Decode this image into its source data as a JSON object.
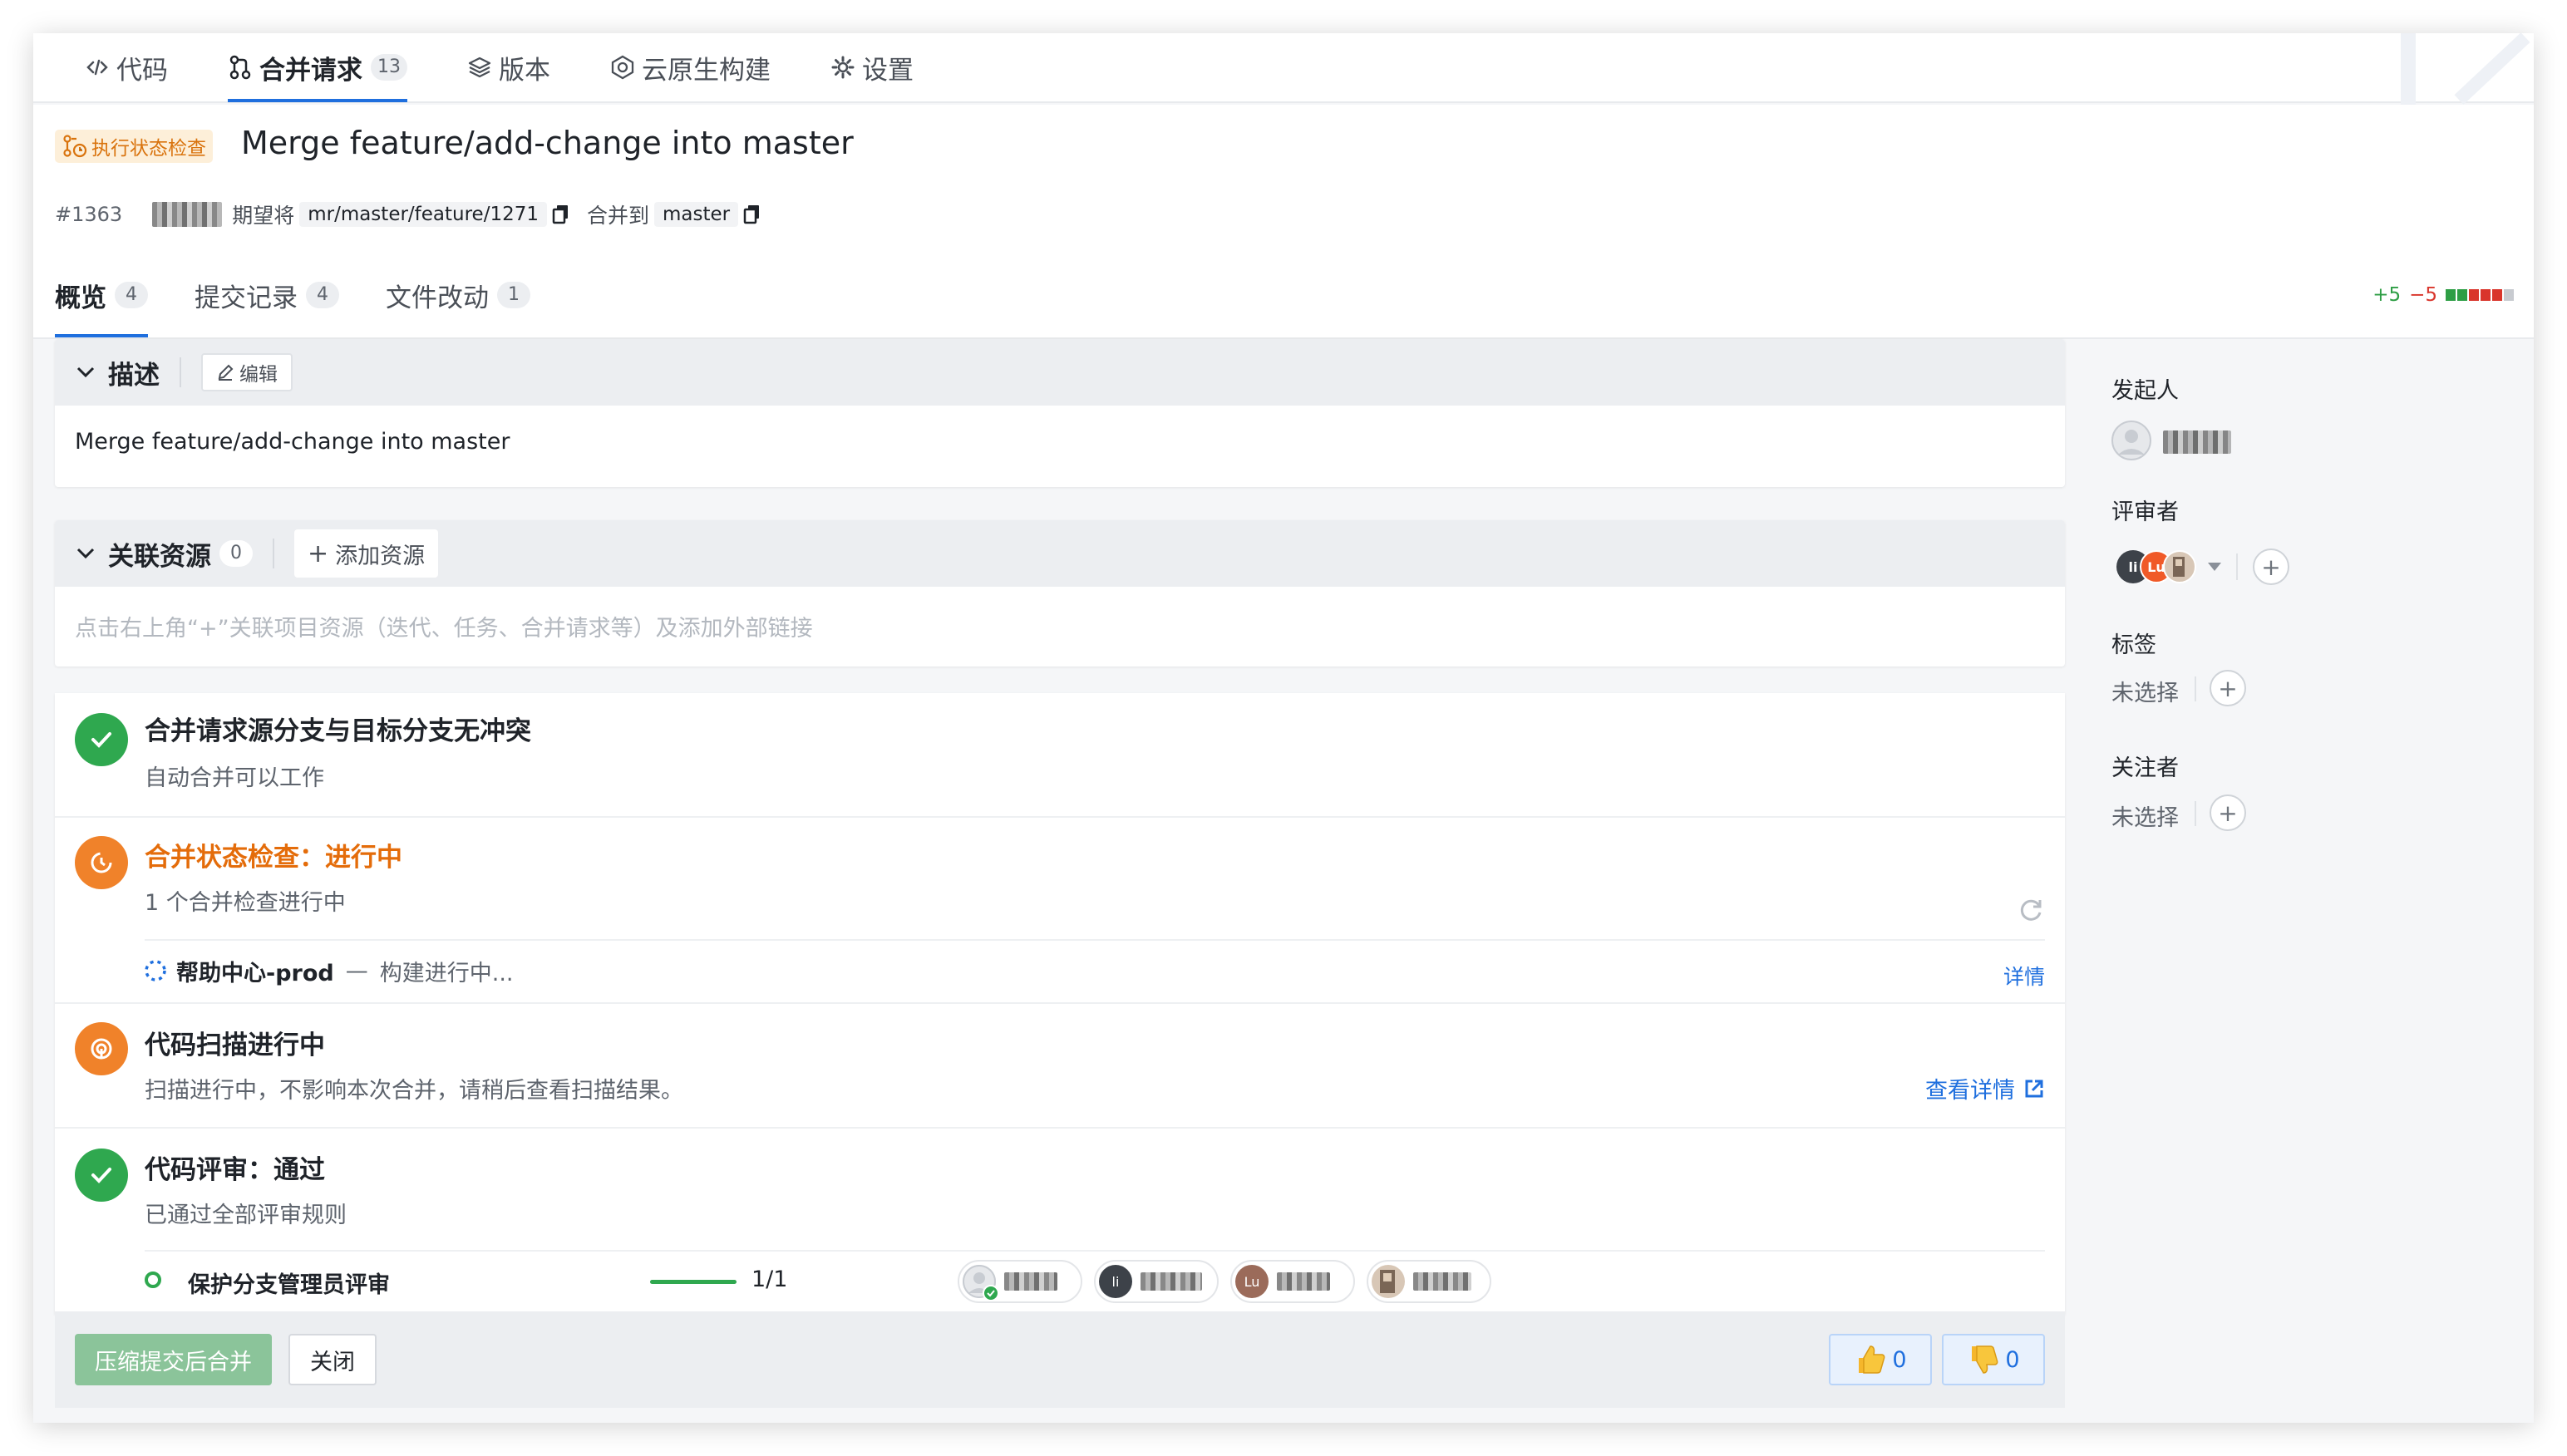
{
  "topnav": {
    "items": [
      {
        "label": "代码",
        "icon": "code-icon"
      },
      {
        "label": "合并请求",
        "icon": "merge-request-icon",
        "count": "13"
      },
      {
        "label": "版本",
        "icon": "layers-icon"
      },
      {
        "label": "云原生构建",
        "icon": "cloud-build-icon"
      },
      {
        "label": "设置",
        "icon": "gear-icon"
      }
    ]
  },
  "header": {
    "status_tag": "执行状态检查",
    "title": "Merge feature/add-change into master",
    "mr_id": "#1363",
    "wish_text": "期望将",
    "source_branch": "mr/master/feature/1271",
    "merge_to_text": "合并到",
    "target_branch": "master"
  },
  "subtabs": [
    {
      "label": "概览",
      "count": "4"
    },
    {
      "label": "提交记录",
      "count": "4"
    },
    {
      "label": "文件改动",
      "count": "1"
    }
  ],
  "diffstat": {
    "additions": "+5",
    "deletions": "−5"
  },
  "description": {
    "title": "描述",
    "edit_label": "编辑",
    "body": "Merge feature/add-change into master"
  },
  "resources": {
    "title": "关联资源",
    "count": "0",
    "add_label": "添加资源",
    "hint": "点击右上角“+”关联项目资源（迭代、任务、合并请求等）及添加外部链接"
  },
  "checks": {
    "conflict": {
      "title": "合并请求源分支与目标分支无冲突",
      "sub": "自动合并可以工作"
    },
    "status": {
      "title": "合并状态检查：进行中",
      "sub": "1 个合并检查进行中",
      "job_name": "帮助中心-prod",
      "job_dash": "—",
      "job_status": "构建进行中...",
      "detail_label": "详情"
    },
    "scan": {
      "title": "代码扫描进行中",
      "sub": "扫描进行中，不影响本次合并，请稍后查看扫描结果。",
      "link_label": "查看详情"
    },
    "review": {
      "title": "代码评审：通过",
      "sub": "已通过全部评审规则",
      "rule_name": "保护分支管理员评审",
      "progress": 1.0,
      "progress_text": "1/1",
      "reviewer_initials": [
        "",
        "li",
        "Lu",
        ""
      ]
    }
  },
  "footer": {
    "squash_merge_label": "压缩提交后合并",
    "close_label": "关闭",
    "thumbs_up_count": "0",
    "thumbs_down_count": "0"
  },
  "sidebar": {
    "author_label": "发起人",
    "reviewers_label": "评审者",
    "reviewer_initials": [
      "li",
      "Lu"
    ],
    "labels_label": "标签",
    "labels_value": "未选择",
    "watchers_label": "关注者",
    "watchers_value": "未选择"
  },
  "colors": {
    "accent": "#1f6fde",
    "success": "#2fa84f",
    "warning": "#f0822a",
    "orange_text": "#e46c0a"
  }
}
